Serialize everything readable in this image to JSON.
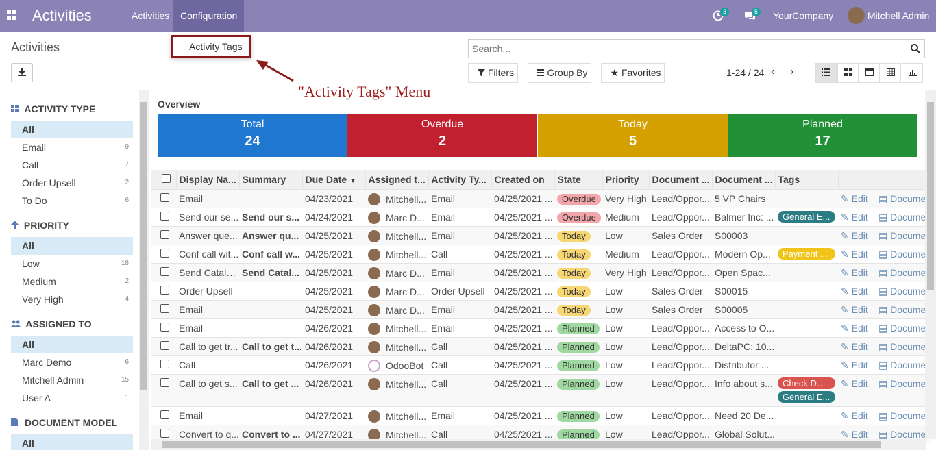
{
  "topbar": {
    "brand": "Activities",
    "menus": [
      "Activities",
      "Configuration"
    ],
    "activity_count": "3",
    "message_count": "5",
    "company": "YourCompany",
    "user": "Mitchell Admin"
  },
  "dropdown": {
    "item": "Activity Tags"
  },
  "annotation": "\"Activity Tags\"  Menu",
  "control_panel": {
    "title": "Activities",
    "search_placeholder": "Search...",
    "filters_label": "Filters",
    "groupby_label": "Group By",
    "favorites_label": "Favorites",
    "pager": "1-24 / 24",
    "views": [
      "list-view-icon",
      "kanban-view-icon",
      "calendar-view-icon",
      "pivot-view-icon",
      "graph-view-icon"
    ]
  },
  "sidebar": {
    "sections": [
      {
        "title": "ACTIVITY TYPE",
        "icon": "grid-icon",
        "items": [
          {
            "label": "All",
            "count": "",
            "selected": true
          },
          {
            "label": "Email",
            "count": "9"
          },
          {
            "label": "Call",
            "count": "7"
          },
          {
            "label": "Order Upsell",
            "count": "2"
          },
          {
            "label": "To Do",
            "count": "6"
          }
        ]
      },
      {
        "title": "PRIORITY",
        "icon": "arrow-up-icon",
        "items": [
          {
            "label": "All",
            "count": "",
            "selected": true
          },
          {
            "label": "Low",
            "count": "18"
          },
          {
            "label": "Medium",
            "count": "2"
          },
          {
            "label": "Very High",
            "count": "4"
          }
        ]
      },
      {
        "title": "ASSIGNED TO",
        "icon": "users-icon",
        "items": [
          {
            "label": "All",
            "count": "",
            "selected": true
          },
          {
            "label": "Marc Demo",
            "count": "6"
          },
          {
            "label": "Mitchell Admin",
            "count": "15"
          },
          {
            "label": "User A",
            "count": "1"
          }
        ]
      },
      {
        "title": "DOCUMENT MODEL",
        "icon": "document-icon",
        "items": [
          {
            "label": "All",
            "count": "",
            "selected": true
          }
        ]
      }
    ]
  },
  "overview": {
    "title": "Overview",
    "cards": [
      {
        "label": "Total",
        "value": "24",
        "color": "#1f77d0"
      },
      {
        "label": "Overdue",
        "value": "2",
        "color": "#c1202f"
      },
      {
        "label": "Today",
        "value": "5",
        "color": "#d3a000"
      },
      {
        "label": "Planned",
        "value": "17",
        "color": "#229036"
      }
    ]
  },
  "table": {
    "columns": [
      "Display Na...",
      "Summary",
      "Due Date",
      "Assigned t...",
      "Activity Ty...",
      "Created on",
      "State",
      "Priority",
      "Document ...",
      "Document ...",
      "Tags"
    ],
    "edit_label": "Edit",
    "document_label": "Docume",
    "rows": [
      {
        "name": "Email",
        "summary": "",
        "due": "04/23/2021",
        "assigned": "Mitchell...",
        "type": "Email",
        "created": "04/25/2021 ...",
        "state": "Overdue",
        "priority": "Very High",
        "model": "Lead/Oppor...",
        "doc": "5 VP Chairs",
        "tags": []
      },
      {
        "name": "Send our se...",
        "summary": "Send our s...",
        "due": "04/24/2021",
        "assigned": "Marc D...",
        "type": "Email",
        "created": "04/25/2021 ...",
        "state": "Overdue",
        "priority": "Medium",
        "model": "Lead/Oppor...",
        "doc": "Balmer Inc: ...",
        "tags": [
          {
            "label": "General E...",
            "color": "#2c7d83"
          }
        ]
      },
      {
        "name": "Answer que...",
        "summary": "Answer qu...",
        "due": "04/25/2021",
        "assigned": "Mitchell...",
        "type": "Email",
        "created": "04/25/2021 ...",
        "state": "Today",
        "priority": "Low",
        "model": "Sales Order",
        "doc": "S00003",
        "tags": []
      },
      {
        "name": "Conf call wit...",
        "summary": "Conf call w...",
        "due": "04/25/2021",
        "assigned": "Mitchell...",
        "type": "Call",
        "created": "04/25/2021 ...",
        "state": "Today",
        "priority": "Medium",
        "model": "Lead/Oppor...",
        "doc": "Modern Op...",
        "tags": [
          {
            "label": "Payment ...",
            "color": "#f0c419"
          }
        ]
      },
      {
        "name": "Send Catalo...",
        "summary": "Send Catal...",
        "due": "04/25/2021",
        "assigned": "Marc D...",
        "type": "Email",
        "created": "04/25/2021 ...",
        "state": "Today",
        "priority": "Very High",
        "model": "Lead/Oppor...",
        "doc": "Open Spac...",
        "tags": []
      },
      {
        "name": "Order Upsell",
        "summary": "",
        "due": "04/25/2021",
        "assigned": "Marc D...",
        "type": "Order Upsell",
        "created": "04/25/2021 ...",
        "state": "Today",
        "priority": "Low",
        "model": "Sales Order",
        "doc": "S00015",
        "tags": []
      },
      {
        "name": "Email",
        "summary": "",
        "due": "04/25/2021",
        "assigned": "Marc D...",
        "type": "Email",
        "created": "04/25/2021 ...",
        "state": "Today",
        "priority": "Low",
        "model": "Sales Order",
        "doc": "S00005",
        "tags": []
      },
      {
        "name": "Email",
        "summary": "",
        "due": "04/26/2021",
        "assigned": "Mitchell...",
        "type": "Email",
        "created": "04/25/2021 ...",
        "state": "Planned",
        "priority": "Low",
        "model": "Lead/Oppor...",
        "doc": "Access to O...",
        "tags": []
      },
      {
        "name": "Call to get tr...",
        "summary": "Call to get t...",
        "due": "04/26/2021",
        "assigned": "Mitchell...",
        "type": "Call",
        "created": "04/25/2021 ...",
        "state": "Planned",
        "priority": "Low",
        "model": "Lead/Oppor...",
        "doc": "DeltaPC: 10...",
        "tags": []
      },
      {
        "name": "Call",
        "summary": "",
        "due": "04/26/2021",
        "assigned": "OdooBot",
        "type": "Call",
        "created": "04/25/2021 ...",
        "state": "Planned",
        "priority": "Low",
        "model": "Lead/Oppor...",
        "doc": "Distributor ...",
        "tags": []
      },
      {
        "name": "Call to get s...",
        "summary": "Call to get ...",
        "due": "04/26/2021",
        "assigned": "Mitchell...",
        "type": "Call",
        "created": "04/25/2021 ...",
        "state": "Planned",
        "priority": "Low",
        "model": "Lead/Oppor...",
        "doc": "Info about s...",
        "tags": [
          {
            "label": "Check Deli...",
            "color": "#d9534f"
          },
          {
            "label": "General E...",
            "color": "#2c7d83"
          }
        ]
      },
      {
        "name": "Email",
        "summary": "",
        "due": "04/27/2021",
        "assigned": "Mitchell...",
        "type": "Email",
        "created": "04/25/2021 ...",
        "state": "Planned",
        "priority": "Low",
        "model": "Lead/Oppor...",
        "doc": "Need 20 De...",
        "tags": []
      },
      {
        "name": "Convert to q...",
        "summary": "Convert to ...",
        "due": "04/27/2021",
        "assigned": "Mitchell...",
        "type": "Call",
        "created": "04/25/2021 ...",
        "state": "Planned",
        "priority": "Low",
        "model": "Lead/Oppor...",
        "doc": "Global Solut...",
        "tags": []
      }
    ]
  },
  "state_colors": {
    "Overdue": "#f4a7ab",
    "Today": "#f7d774",
    "Planned": "#9fd8a0"
  }
}
